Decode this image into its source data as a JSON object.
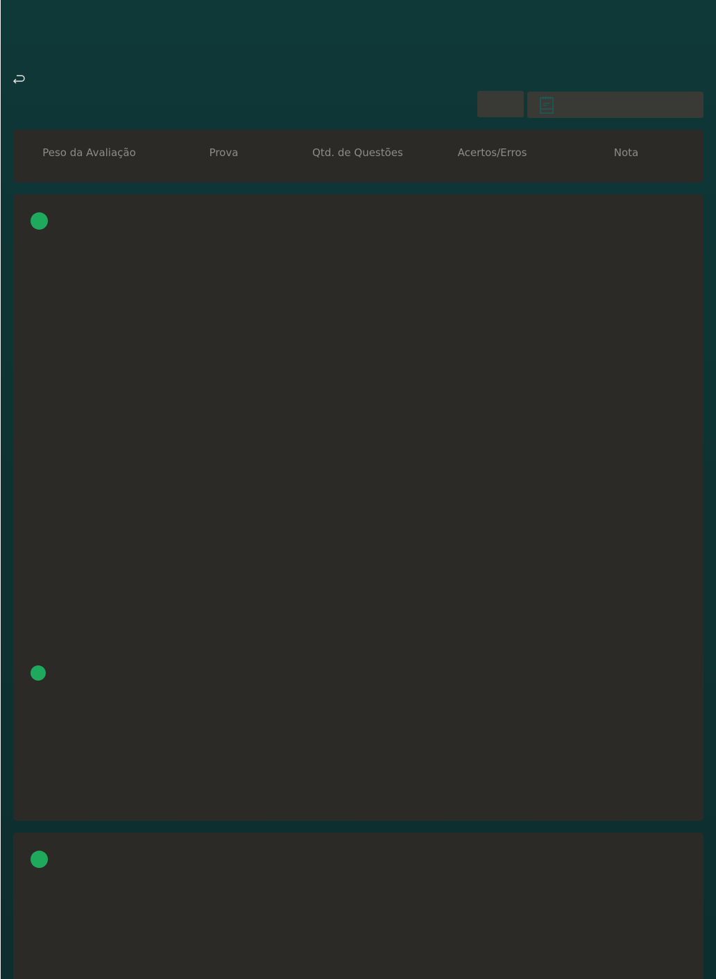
{
  "toolbar": {
    "back_icon": "return-arrow-icon",
    "select_icon": "document-icon"
  },
  "table_header": {
    "columns": [
      "Peso da Avaliação",
      "Prova",
      "Qtd. de Questões",
      "Acertos/Erros",
      "Nota"
    ]
  },
  "colors": {
    "background": "#0e3434",
    "card": "#2b2a27",
    "control": "#393936",
    "header_text": "#8c8b87",
    "status_dot": "#1fa95d"
  }
}
